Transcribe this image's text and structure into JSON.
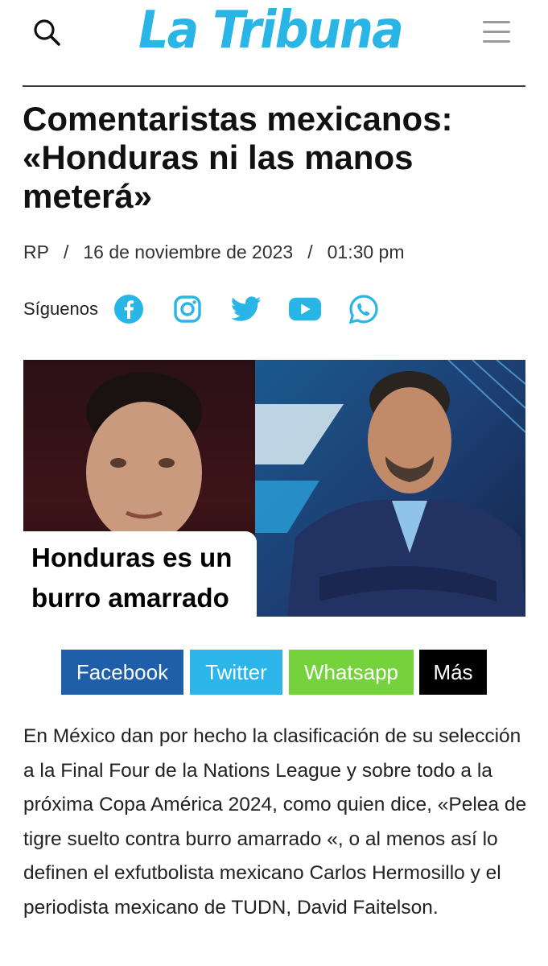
{
  "header": {
    "logo_text": "La Tribuna",
    "brand_color": "#29b6e6",
    "search_icon": "search-icon",
    "menu_icon": "hamburger-menu-icon"
  },
  "article": {
    "title_lines": [
      "Comentaristas mexicanos:",
      "«Honduras ni las manos",
      "meterá»"
    ],
    "author": "RP",
    "date": "16 de noviembre de 2023",
    "time": "01:30 pm",
    "separator": "/"
  },
  "follow": {
    "label": "Síguenos",
    "icons": [
      "facebook-icon",
      "instagram-icon",
      "twitter-icon",
      "youtube-icon",
      "whatsapp-icon"
    ]
  },
  "hero": {
    "caption_lines": [
      "Honduras es un",
      "burro amarrado"
    ]
  },
  "share": {
    "facebook": "Facebook",
    "twitter": "Twitter",
    "whatsapp": "Whatsapp",
    "more": "Más",
    "colors": {
      "facebook": "#1f5ea8",
      "twitter": "#2bb5e8",
      "whatsapp": "#76d23c",
      "more": "#000000"
    }
  },
  "body": {
    "paragraph": "En México dan por hecho la clasificación de su selección a la Final Four de la Nations League y sobre todo a la próxima Copa América 2024, como quien dice, «Pelea de tigre suelto contra burro amarrado «, o al menos así lo definen el exfutbolista mexicano Carlos Hermosillo y el periodista mexicano de TUDN, David Faitelson."
  }
}
